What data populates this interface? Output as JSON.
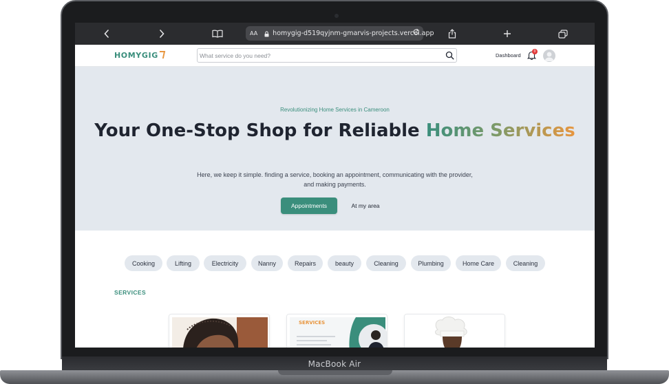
{
  "device": {
    "label": "MacBook Air"
  },
  "browser": {
    "reader_label": "AA",
    "url": "homygig-d519qyjnm-gmarvis-projects.vercel.app"
  },
  "header": {
    "logo_text": "HOMYGIG",
    "search_placeholder": "What service do you need?",
    "dashboard_label": "Dashboard",
    "notification_count": "0"
  },
  "hero": {
    "kicker": "Revolutionizing Home Services in Cameroon",
    "title_plain": "Your One-Stop Shop for Reliable ",
    "title_accent": "Home Services",
    "description": "Here, we keep it simple. finding a service, booking an appointment, communicating with the provider, and making payments.",
    "primary_button": "Appointments",
    "secondary_button": "At my area"
  },
  "categories": [
    "Cooking",
    "Lifting",
    "Electricity",
    "Nanny",
    "Repairs",
    "beauty",
    "Cleaning",
    "Plumbing",
    "Home Care",
    "Cleaning"
  ],
  "services": {
    "section_title": "SERVICES",
    "card2_banner": "SERVICES"
  },
  "colors": {
    "brand": "#3a8e7c",
    "accent": "#e8963f",
    "hero_bg": "#e3e8ee",
    "chip_bg": "#e3e8ee",
    "text_dark": "#1f2430"
  }
}
